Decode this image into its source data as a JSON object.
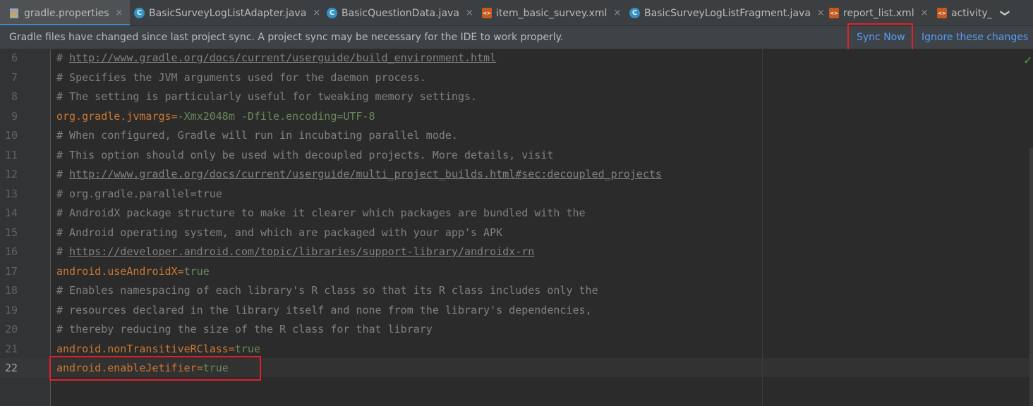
{
  "tabs": [
    {
      "label": "gradle.properties",
      "icon": "gradle-file-icon",
      "active": true
    },
    {
      "label": "BasicSurveyLogListAdapter.java",
      "icon": "java-class-icon"
    },
    {
      "label": "BasicQuestionData.java",
      "icon": "java-class-icon"
    },
    {
      "label": "item_basic_survey.xml",
      "icon": "xml-file-icon"
    },
    {
      "label": "BasicSurveyLogListFragment.java",
      "icon": "java-class-icon"
    },
    {
      "label": "report_list.xml",
      "icon": "xml-file-icon"
    },
    {
      "label": "activity_",
      "icon": "xml-file-icon"
    }
  ],
  "icons": {
    "class_letter": "C",
    "xml_text": "<>",
    "close": "×",
    "more": "❯",
    "check": "✓"
  },
  "notification": {
    "message": "Gradle files have changed since last project sync. A project sync may be necessary for the IDE to work properly.",
    "sync_now": "Sync Now",
    "ignore": "Ignore these changes"
  },
  "lines": [
    {
      "n": "6",
      "parts": [
        {
          "t": "# ",
          "c": "comment"
        },
        {
          "t": "http://www.gradle.org/docs/current/userguide/build_environment.html",
          "c": "url"
        }
      ]
    },
    {
      "n": "7",
      "parts": [
        {
          "t": "# Specifies the JVM arguments used for the daemon process.",
          "c": "comment"
        }
      ]
    },
    {
      "n": "8",
      "parts": [
        {
          "t": "# The setting is particularly useful for tweaking memory settings.",
          "c": "comment"
        }
      ]
    },
    {
      "n": "9",
      "parts": [
        {
          "t": "org.gradle.jvmargs",
          "c": "key"
        },
        {
          "t": "=",
          "c": "eq"
        },
        {
          "t": "-Xmx2048m -Dfile.encoding=UTF-8",
          "c": "val"
        }
      ]
    },
    {
      "n": "10",
      "parts": [
        {
          "t": "# When configured, Gradle will run in incubating parallel mode.",
          "c": "comment"
        }
      ]
    },
    {
      "n": "11",
      "parts": [
        {
          "t": "# This option should only be used with decoupled projects. More details, visit",
          "c": "comment"
        }
      ]
    },
    {
      "n": "12",
      "parts": [
        {
          "t": "# ",
          "c": "comment"
        },
        {
          "t": "http://www.gradle.org/docs/current/userguide/multi_project_builds.html#sec:decoupled_projects",
          "c": "url"
        }
      ]
    },
    {
      "n": "13",
      "parts": [
        {
          "t": "# org.gradle.parallel=true",
          "c": "comment"
        }
      ]
    },
    {
      "n": "14",
      "parts": [
        {
          "t": "# AndroidX package structure to make it clearer which packages are bundled with the",
          "c": "comment"
        }
      ]
    },
    {
      "n": "15",
      "parts": [
        {
          "t": "# Android operating system, and which are packaged with your app's APK",
          "c": "comment"
        }
      ]
    },
    {
      "n": "16",
      "parts": [
        {
          "t": "# ",
          "c": "comment"
        },
        {
          "t": "https://developer.android.com/topic/libraries/support-library/androidx-rn",
          "c": "url"
        }
      ]
    },
    {
      "n": "17",
      "parts": [
        {
          "t": "android.useAndroidX",
          "c": "key"
        },
        {
          "t": "=",
          "c": "eq"
        },
        {
          "t": "true",
          "c": "val"
        }
      ]
    },
    {
      "n": "18",
      "parts": [
        {
          "t": "# Enables namespacing of each library's R class so that its R class includes only the",
          "c": "comment"
        }
      ]
    },
    {
      "n": "19",
      "parts": [
        {
          "t": "# resources declared in the library itself and none from the library's dependencies,",
          "c": "comment"
        }
      ]
    },
    {
      "n": "20",
      "parts": [
        {
          "t": "# thereby reducing the size of the R class for that library",
          "c": "comment"
        }
      ]
    },
    {
      "n": "21",
      "parts": [
        {
          "t": "android.nonTransitiveRClass",
          "c": "key"
        },
        {
          "t": "=",
          "c": "eq"
        },
        {
          "t": "true",
          "c": "val"
        }
      ]
    },
    {
      "n": "22",
      "parts": [
        {
          "t": "android.enableJetifier",
          "c": "key"
        },
        {
          "t": "=",
          "c": "eq"
        },
        {
          "t": "true",
          "c": "val"
        }
      ],
      "current": true
    }
  ],
  "colors": {
    "accent": "#4a88c7",
    "highlight_box": "#e0202a",
    "link": "#589df6"
  }
}
